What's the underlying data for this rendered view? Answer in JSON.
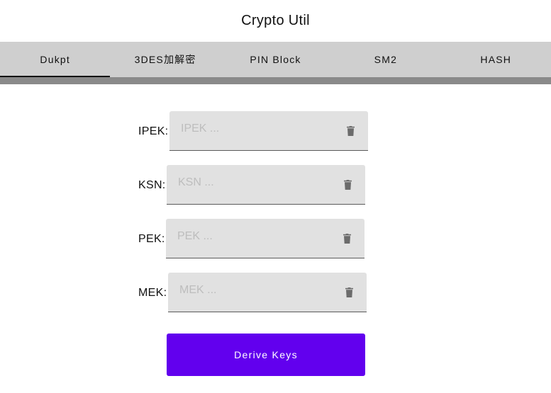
{
  "app": {
    "title": "Crypto Util"
  },
  "tabs": [
    {
      "label": "Dukpt",
      "active": true
    },
    {
      "label": "3DES加解密",
      "active": false
    },
    {
      "label": "PIN Block",
      "active": false
    },
    {
      "label": "SM2",
      "active": false
    },
    {
      "label": "HASH",
      "active": false
    }
  ],
  "form": {
    "fields": [
      {
        "label": "IPEK:",
        "placeholder": "IPEK ...",
        "value": "",
        "icon": "trash-icon"
      },
      {
        "label": "KSN:",
        "placeholder": "KSN ...",
        "value": "",
        "icon": "trash-icon"
      },
      {
        "label": "PEK:",
        "placeholder": "PEK ...",
        "value": "",
        "icon": "trash-icon"
      },
      {
        "label": "MEK:",
        "placeholder": "MEK ...",
        "value": "",
        "icon": "trash-icon"
      }
    ],
    "submit_label": "Derive Keys"
  },
  "colors": {
    "accent": "#6200ee",
    "tab_bar": "#cfcfcf",
    "tab_rule": "#8a8a8a",
    "field_bg": "#e1e1e1",
    "icon": "#6b6b6b"
  }
}
